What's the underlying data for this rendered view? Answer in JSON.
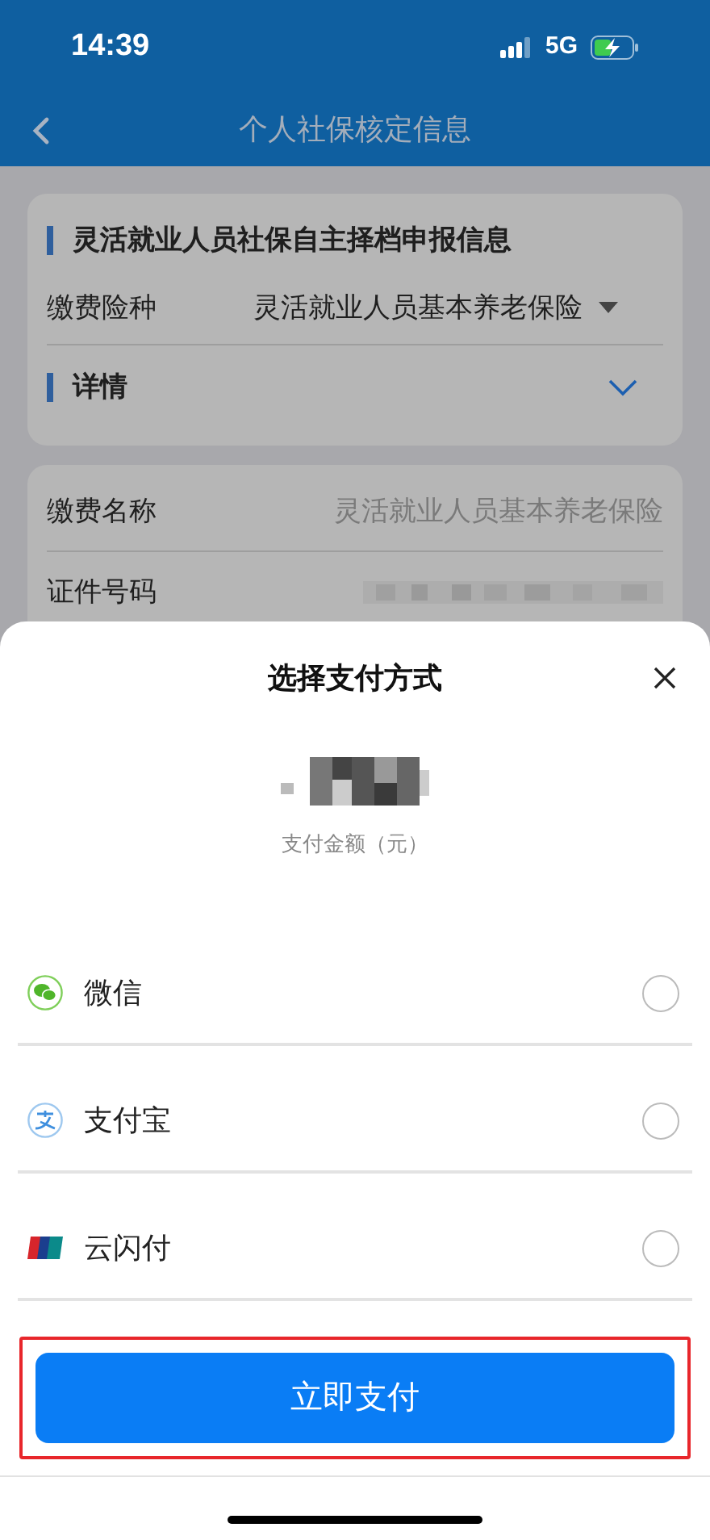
{
  "status_bar": {
    "time": "14:39",
    "network": "5G"
  },
  "nav": {
    "title": "个人社保核定信息"
  },
  "section": {
    "title": "灵活就业人员社保自主择档申报信息",
    "field": {
      "label": "缴费险种",
      "value": "灵活就业人员基本养老保险"
    },
    "details": {
      "title": "详情",
      "expanded": false
    }
  },
  "details_rows": [
    {
      "label": "缴费名称",
      "value": "灵活就业人员基本养老保险"
    },
    {
      "label": "证件号码"
    }
  ],
  "payment_sheet": {
    "title": "选择支付方式",
    "amount_label": "支付金额（元）",
    "methods": [
      {
        "kind": "wechat",
        "label": "微信",
        "selected": false
      },
      {
        "kind": "alipay",
        "label": "支付宝",
        "selected": false
      },
      {
        "kind": "unionpay",
        "label": "云闪付",
        "selected": false
      }
    ],
    "pay_button": {
      "label": "立即支付",
      "highlighted": true
    }
  }
}
